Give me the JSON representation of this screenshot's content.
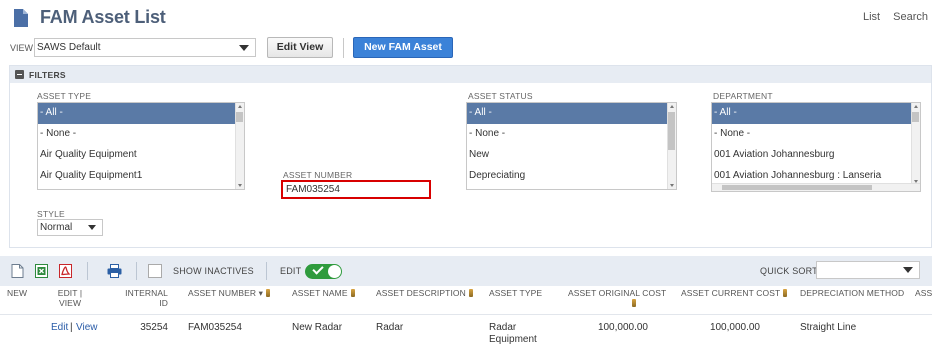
{
  "header": {
    "title": "FAM Asset List",
    "links": [
      "List",
      "Search"
    ]
  },
  "view": {
    "label": "VIEW",
    "selected": "SAWS Default",
    "edit_view_label": "Edit View",
    "new_button_label": "New FAM Asset"
  },
  "filters": {
    "title": "FILTERS",
    "asset_type": {
      "label": "ASSET TYPE",
      "options": [
        "- All -",
        "- None -",
        "Air Quality Equipment",
        "Air Quality Equipment1"
      ],
      "selected": "- All -"
    },
    "asset_number": {
      "label": "ASSET NUMBER",
      "value": "FAM035254"
    },
    "asset_status": {
      "label": "ASSET STATUS",
      "options": [
        "- All -",
        "- None -",
        "New",
        "Depreciating"
      ],
      "selected": "- All -"
    },
    "department": {
      "label": "DEPARTMENT",
      "options": [
        "- All -",
        "- None -",
        "001 Aviation Johannesburg",
        "001 Aviation Johannesburg : Lanseria"
      ],
      "selected": "- All -"
    },
    "style": {
      "label": "STYLE",
      "selected": "Normal"
    }
  },
  "toolbar": {
    "show_inactives_label": "SHOW INACTIVES",
    "edit_label": "EDIT",
    "edit_enabled": true,
    "quick_sort_label": "QUICK SORT",
    "quick_sort_value": ""
  },
  "table": {
    "columns": {
      "new": "NEW",
      "edit_view": [
        "EDIT |",
        "VIEW"
      ],
      "internal_id": [
        "INTERNAL",
        "ID"
      ],
      "asset_number": "ASSET NUMBER ▾",
      "asset_name": "ASSET NAME",
      "asset_description": "ASSET DESCRIPTION",
      "asset_type": "ASSET TYPE",
      "original_cost": "ASSET ORIGINAL COST",
      "current_cost": "ASSET CURRENT COST",
      "depreciation_method": "DEPRECIATION METHOD",
      "overflow": "ASSE"
    },
    "rows": [
      {
        "edit": "Edit",
        "divider": "|",
        "view": "View",
        "internal_id": "35254",
        "asset_number": "FAM035254",
        "asset_name": "New Radar",
        "asset_description": "Radar",
        "asset_type": [
          "Radar",
          "Equipment"
        ],
        "original_cost": "100,000.00",
        "current_cost": "100,000.00",
        "depreciation_method": "Straight Line"
      }
    ]
  },
  "colors": {
    "title": "#4d5f79",
    "primary_button": "#3b82d8",
    "selected_option": "#5a7aa6",
    "toggle_on": "#2f9b3d",
    "highlight_border": "#d80000",
    "link": "#2a5ca8"
  }
}
